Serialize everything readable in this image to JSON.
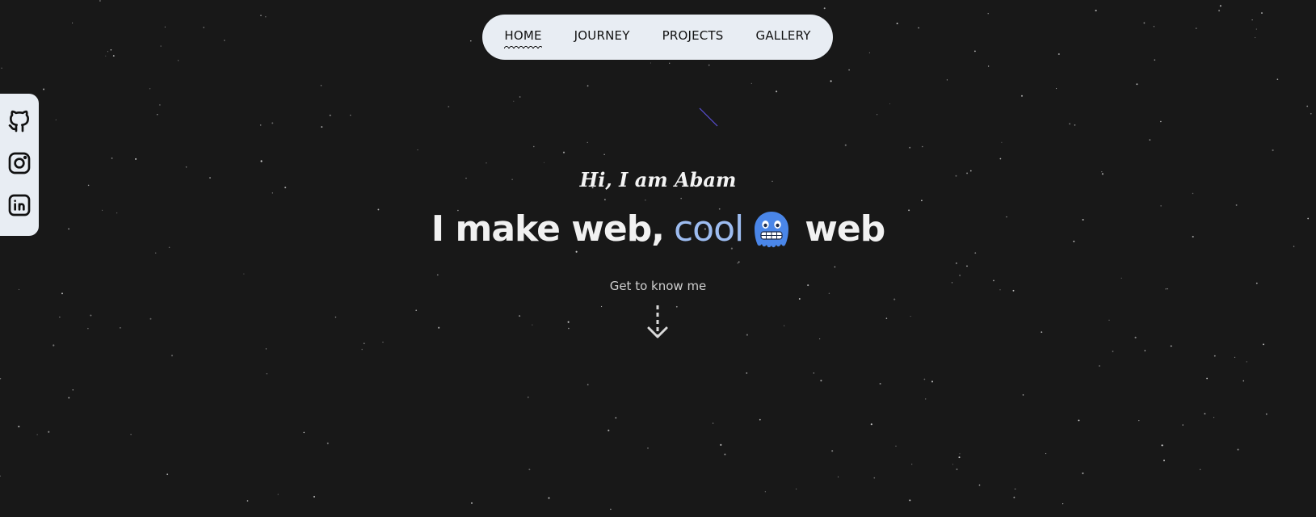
{
  "nav": {
    "items": [
      {
        "label": "HOME",
        "active": true
      },
      {
        "label": "JOURNEY",
        "active": false
      },
      {
        "label": "PROJECTS",
        "active": false
      },
      {
        "label": "GALLERY",
        "active": false
      }
    ]
  },
  "social": {
    "icons": [
      "github-icon",
      "instagram-icon",
      "linkedin-icon"
    ]
  },
  "hero": {
    "greeting": "Hi, I am Abam",
    "headline_prefix": "I make web,",
    "headline_accent": "cool",
    "emoji_icon": "cold-face-emoji-icon",
    "headline_suffix": "web",
    "cta": "Get to know me",
    "arrow_icon": "down-arrow-icon"
  },
  "colors": {
    "background": "#181818",
    "panel": "#e8edf3",
    "accent": "#9dbcf0",
    "emoji": "#4a86e8"
  }
}
